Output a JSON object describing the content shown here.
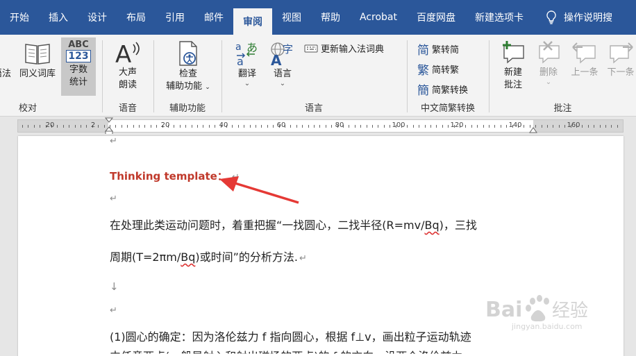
{
  "tabs": [
    "开始",
    "插入",
    "设计",
    "布局",
    "引用",
    "邮件",
    "审阅",
    "视图",
    "帮助",
    "Acrobat",
    "百度网盘",
    "新建选项卡"
  ],
  "active_tab": "审阅",
  "tell_me": "操作说明搜",
  "ribbon": {
    "proofing": {
      "label": "校对",
      "spelling_partial": "语法",
      "thesaurus": "同义词库",
      "wordcount_line1": "字数",
      "wordcount_line2": "统计",
      "wordcount_icon_text": "ABC",
      "wordcount_icon_num": "123"
    },
    "speech": {
      "label": "语音",
      "read_aloud_line1": "大声",
      "read_aloud_line2": "朗读"
    },
    "accessibility": {
      "label": "辅助功能",
      "check_line1": "检查",
      "check_line2": "辅助功能"
    },
    "language": {
      "label": "语言",
      "translate": "翻译",
      "language": "语言",
      "update_ime": "更新输入法词典"
    },
    "chinese_conversion": {
      "label": "中文简繁转换",
      "to_simplified": "繁转简",
      "to_traditional": "简转繁",
      "convert": "简繁转换"
    },
    "comments": {
      "label": "批注",
      "new_line1": "新建",
      "new_line2": "批注",
      "delete": "删除",
      "previous": "上一条",
      "next": "下一条"
    }
  },
  "ruler": {
    "labels": [
      "20",
      "2",
      "20",
      "40",
      "60",
      "80",
      "100",
      "120",
      "140",
      "160"
    ]
  },
  "document": {
    "heading": "Thinking template：",
    "para1_a": "在处理此类运动问题时，着重把握“一找圆心，二找半径(R=mv/",
    "para1_b": "Bq",
    "para1_c": ")，三找",
    "para2_a": "周期(T=2πm/",
    "para2_b": "Bq",
    "para2_c": ")或时间”的分析方法.",
    "para3": "(1)圆心的确定：因为洛伦兹力 f 指向圆心，根据 f⊥v，画出粒子运动轨迹",
    "para4": "中任意两点(一般是射入和射出磁场的两点)的 f 的方向，沿两个洛伦兹力"
  },
  "watermark": {
    "text": "Bai",
    "text2": "经验",
    "domain": "jingyan.baidu.com"
  },
  "colors": {
    "tab_bar": "#2b579a",
    "heading": "#c0392b",
    "arrow": "#e53935"
  }
}
